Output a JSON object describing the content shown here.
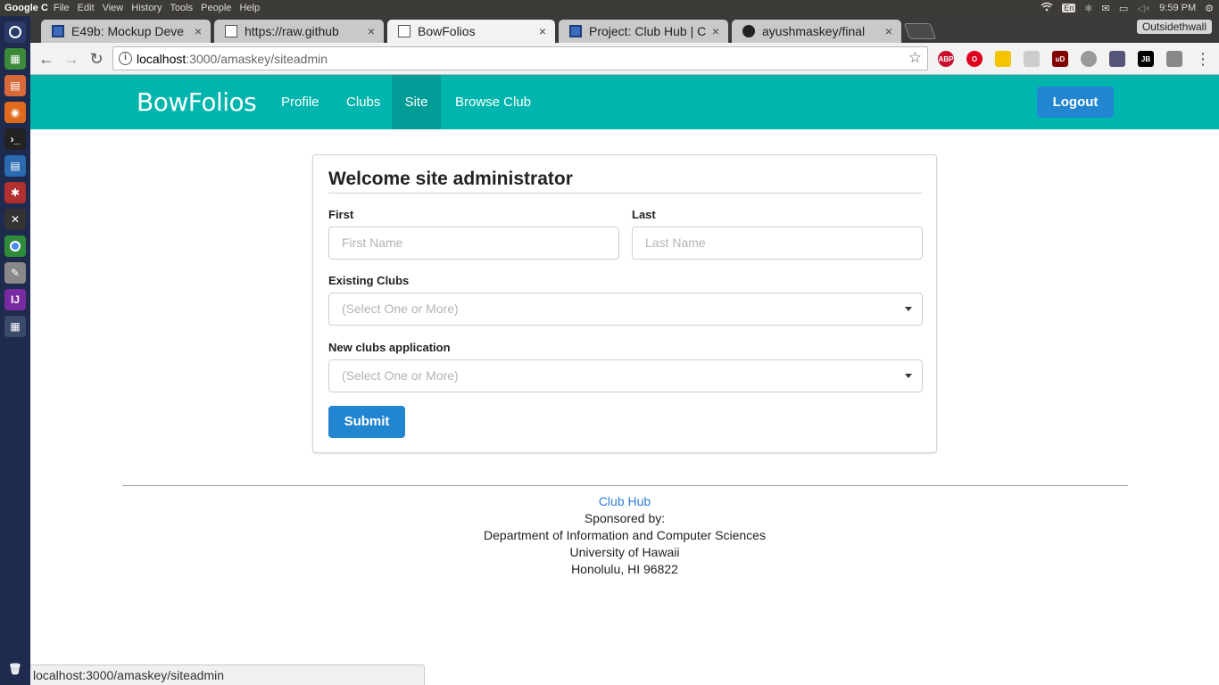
{
  "os_panel": {
    "app_name": "Google C",
    "menus": [
      "File",
      "Edit",
      "View",
      "History",
      "Tools",
      "People",
      "Help"
    ],
    "keyboard": "En",
    "clock": "9:59 PM"
  },
  "browser": {
    "profile_name": "Outsidethwall",
    "tabs": [
      {
        "title": "E49b: Mockup Deve",
        "favicon": "doc-icon"
      },
      {
        "title": "https://raw.github",
        "favicon": "page-icon"
      },
      {
        "title": "BowFolios",
        "favicon": "page-icon"
      },
      {
        "title": "Project: Club Hub | C",
        "favicon": "doc-icon"
      },
      {
        "title": "ayushmaskey/final",
        "favicon": "github-icon"
      }
    ],
    "close_glyph": "×",
    "url_host": "localhost",
    "url_rest": ":3000/amaskey/siteadmin",
    "extensions": [
      "ABP",
      "O",
      "",
      "",
      "uD",
      "",
      "",
      "JB",
      ""
    ],
    "status_url": "localhost:3000/amaskey/siteadmin"
  },
  "navbar": {
    "brand": "BowFolios",
    "items": [
      "Profile",
      "Clubs",
      "Site",
      "Browse Club"
    ],
    "active_item": "Site",
    "logout": "Logout"
  },
  "form": {
    "title": "Welcome site administrator",
    "first_label": "First",
    "first_placeholder": "First Name",
    "last_label": "Last",
    "last_placeholder": "Last Name",
    "existing_label": "Existing Clubs",
    "existing_placeholder": "(Select One or More)",
    "new_label": "New clubs application",
    "new_placeholder": "(Select One or More)",
    "submit": "Submit"
  },
  "footer": {
    "link": "Club Hub",
    "line1": "Sponsored by:",
    "line2": "Department of Information and Computer Sciences",
    "line3": "University of Hawaii",
    "line4": "Honolulu, HI 96822"
  },
  "colors": {
    "navbar": "#00b5ad",
    "navbar_active": "#009c95",
    "primary_button": "#2185d0",
    "link": "#2e7bd6"
  }
}
